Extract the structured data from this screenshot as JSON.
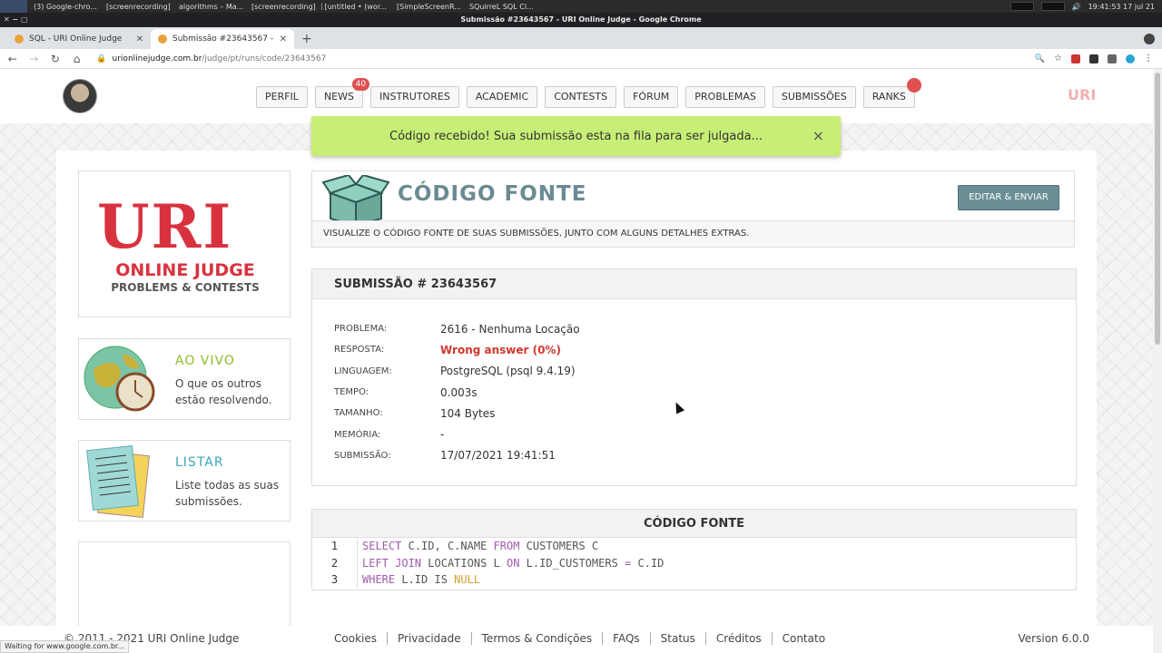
{
  "taskbar": {
    "tasks": [
      "(3) Google-chro...",
      "[screenrecording]",
      "algorithms – Ma...",
      "[screenrecording]",
      "[untitled • (wor...",
      "[SimpleScreenR...",
      "SQuirreL SQL Cl..."
    ],
    "clock": "19:41:53  17 jul 21"
  },
  "window": {
    "title": "Submissão #23643567 - URI Online Judge - Google Chrome"
  },
  "tabs": [
    {
      "label": "SQL - URI Online Judge"
    },
    {
      "label": "Submissão #23643567 - URI O"
    }
  ],
  "address": {
    "host": "urionlinejudge.com.br",
    "path": "/judge/pt/runs/code/23643567"
  },
  "nav": {
    "items": [
      "PERFIL",
      "NEWS",
      "INSTRUTORES",
      "ACADEMIC",
      "CONTESTS",
      "FÓRUM",
      "PROBLEMAS",
      "SUBMISSÕES",
      "RANKS"
    ],
    "news_badge": "40",
    "brand_mini": "URI"
  },
  "toast": {
    "message": "Código recebido! Sua submissão esta na fila para ser julgada...",
    "close": "×"
  },
  "sidebar": {
    "logo": {
      "big": "URI",
      "line1": "ONLINE JUDGE",
      "line2": "PROBLEMS & CONTESTS"
    },
    "live": {
      "title": "AO VIVO",
      "desc": "O que os outros estão resolvendo.",
      "color": "#8cbd2a"
    },
    "list": {
      "title": "LISTAR",
      "desc": "Liste todas as suas submissões.",
      "color": "#3aa6b9"
    }
  },
  "header": {
    "title": "CÓDIGO FONTE",
    "button": "EDITAR & ENVIAR",
    "subtitle": "VISUALIZE O CÓDIGO FONTE DE SUAS SUBMISSÕES, JUNTO COM ALGUNS DETALHES EXTRAS."
  },
  "submission": {
    "heading": "SUBMISSÃO # 23643567",
    "rows": [
      {
        "label": "PROBLEMA:",
        "value": "2616 - Nenhuma Locação"
      },
      {
        "label": "RESPOSTA:",
        "value": "Wrong answer (0%)"
      },
      {
        "label": "LINGUAGEM:",
        "value": "PostgreSQL (psql 9.4.19)"
      },
      {
        "label": "TEMPO:",
        "value": "0.003s"
      },
      {
        "label": "TAMANHO:",
        "value": "104 Bytes"
      },
      {
        "label": "MEMÓRIA:",
        "value": "-"
      },
      {
        "label": "SUBMISSÃO:",
        "value": "17/07/2021 19:41:51"
      }
    ]
  },
  "code": {
    "heading": "CÓDIGO FONTE",
    "lines": [
      {
        "n": "1",
        "tokens": [
          [
            "kw",
            "SELECT"
          ],
          [
            "",
            "C.ID, C.NAME "
          ],
          [
            "kw",
            "FROM"
          ],
          [
            "",
            "CUSTOMERS C"
          ]
        ]
      },
      {
        "n": "2",
        "tokens": [
          [
            "kw",
            "LEFT JOIN"
          ],
          [
            "",
            "LOCATIONS L "
          ],
          [
            "kw",
            "ON"
          ],
          [
            "",
            "L.ID_CUSTOMERS "
          ],
          [
            "kw",
            "="
          ],
          [
            "",
            "C.ID"
          ]
        ]
      },
      {
        "n": "3",
        "tokens": [
          [
            "kw",
            "WHERE"
          ],
          [
            "",
            "L.ID IS "
          ],
          [
            "nul",
            "NULL"
          ]
        ]
      }
    ]
  },
  "footer": {
    "copyright": "© 2011 - 2021 URI Online Judge",
    "links": [
      "Cookies",
      "Privacidade",
      "Termos & Condições",
      "FAQs",
      "Status",
      "Créditos",
      "Contato"
    ],
    "version": "Version 6.0.0"
  },
  "status": "Waiting for www.google.com.br..."
}
